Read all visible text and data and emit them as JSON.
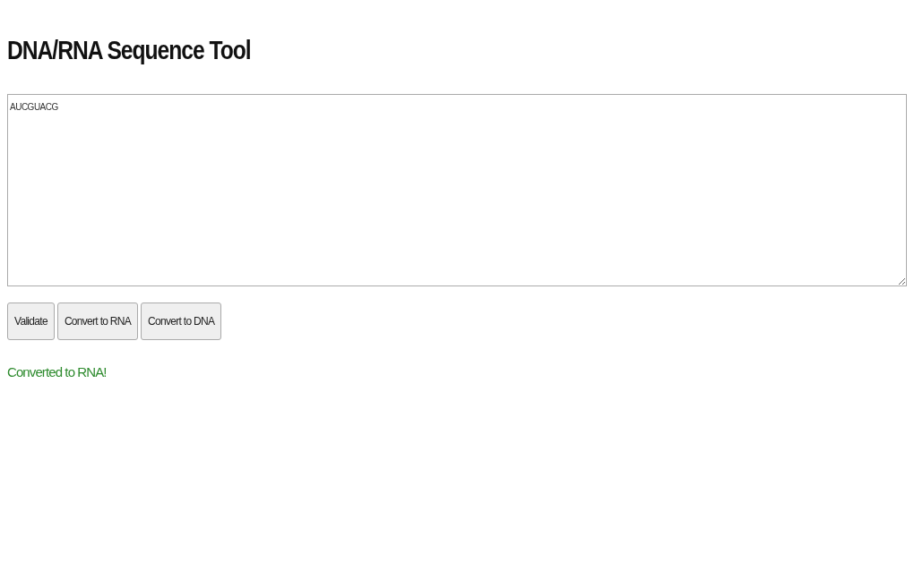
{
  "title": "DNA/RNA Sequence Tool",
  "sequence_input": {
    "value": "AUCGUACG"
  },
  "buttons": [
    "Validate",
    "Convert to RNA",
    "Convert to DNA"
  ],
  "message": {
    "text": "Converted to RNA!",
    "kind": "success"
  }
}
